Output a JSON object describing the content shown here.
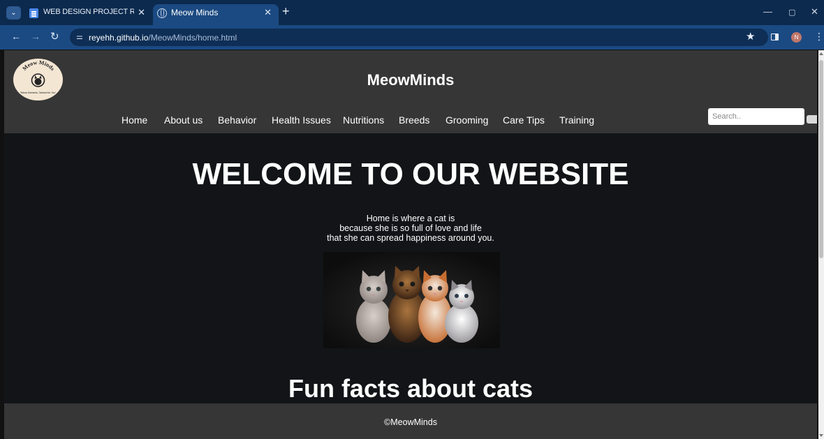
{
  "browser": {
    "tabs": [
      {
        "title": "WEB DESIGN PROJECT REPORT",
        "close": "✕",
        "active": false
      },
      {
        "title": "Meow Minds",
        "close": "✕",
        "active": true
      }
    ],
    "new_tab": "+",
    "url_host": "reyehh.github.io",
    "url_path": "/MeowMinds/home.html",
    "profile_initial": "N",
    "icons": [
      "tab-menu-icon",
      "docs-icon",
      "globe-icon",
      "back-icon",
      "forward-icon",
      "reload-icon",
      "site-info-icon",
      "bookmark-star-icon",
      "side-panel-icon",
      "kebab-menu-icon"
    ]
  },
  "site": {
    "logo_text_top": "Meow Minds",
    "logo_text_bottom": "\"Meow Moments, Tailored for You\"",
    "title": "MeowMinds",
    "nav": [
      "Home",
      "About us",
      "Behavior",
      "Health Issues",
      "Nutritions",
      "Breeds",
      "Grooming",
      "Care Tips",
      "Training"
    ],
    "search_placeholder": "Search..",
    "hero_title": "WELCOME TO OUR WEBSITE",
    "tagline": [
      "Home is where a cat is",
      "because she is so full of love and life",
      "that she can spread happiness around you."
    ],
    "section_title": "Fun facts about cats",
    "footer": "©MeowMinds"
  },
  "colors": {
    "tab_bar": "#0c2a4e",
    "toolbar": "#1b4a82",
    "header_bg": "#363636",
    "page_bg": "#121417",
    "text": "#ffffff"
  }
}
